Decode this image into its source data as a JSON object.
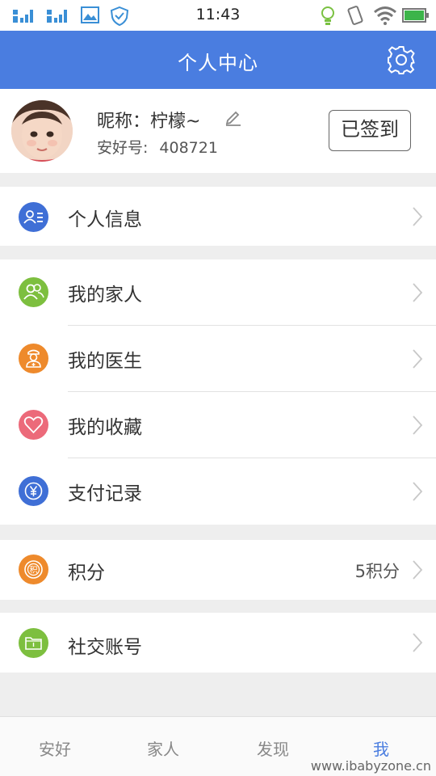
{
  "status_bar": {
    "time": "11:43"
  },
  "header": {
    "title": "个人中心"
  },
  "profile": {
    "nickname": "昵称：柠檬~",
    "uid_label": "安好号:",
    "uid_value": "408721",
    "checkin_label": "已签到"
  },
  "menu": {
    "personal_info": "个人信息",
    "my_family": "我的家人",
    "my_doctor": "我的医生",
    "my_favorites": "我的收藏",
    "payment_records": "支付记录",
    "points": "积分",
    "points_value": "5积分",
    "social_accounts": "社交账号"
  },
  "tabs": [
    "安好",
    "家人",
    "发现",
    "我"
  ],
  "watermark": "www.ibabyzone.cn",
  "colors": {
    "primary": "#4a7de0",
    "green": "#7dbf3f",
    "orange": "#ee8a2c",
    "pink": "#ec6a7a",
    "blue": "#3f6fd6"
  },
  "icons": {
    "personal_info": "id-card-icon",
    "my_family": "people-icon",
    "my_doctor": "doctor-icon",
    "my_favorites": "heart-icon",
    "payment_records": "yuan-icon",
    "points": "points-icon",
    "social_accounts": "folder-icon"
  }
}
